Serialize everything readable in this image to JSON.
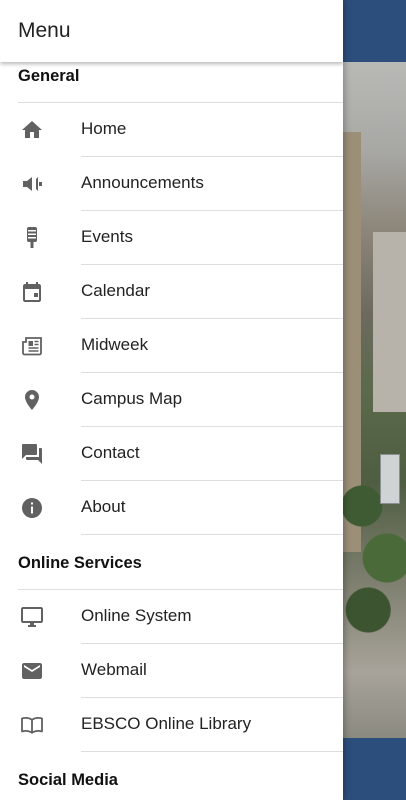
{
  "drawer": {
    "title": "Menu",
    "sections": [
      {
        "title": "General",
        "items": [
          {
            "label": "Home",
            "icon": "home-icon"
          },
          {
            "label": "Announcements",
            "icon": "megaphone-icon"
          },
          {
            "label": "Events",
            "icon": "microphone-icon"
          },
          {
            "label": "Calendar",
            "icon": "calendar-icon"
          },
          {
            "label": "Midweek",
            "icon": "newspaper-icon"
          },
          {
            "label": "Campus Map",
            "icon": "map-pin-icon"
          },
          {
            "label": "Contact",
            "icon": "chat-icon"
          },
          {
            "label": "About",
            "icon": "info-icon"
          }
        ]
      },
      {
        "title": "Online Services",
        "items": [
          {
            "label": "Online System",
            "icon": "monitor-icon"
          },
          {
            "label": "Webmail",
            "icon": "mail-icon"
          },
          {
            "label": "EBSCO Online Library",
            "icon": "book-icon"
          }
        ]
      },
      {
        "title": "Social Media",
        "items": []
      }
    ]
  },
  "colors": {
    "icon": "#616161",
    "appbar": "#2b4e7c"
  }
}
